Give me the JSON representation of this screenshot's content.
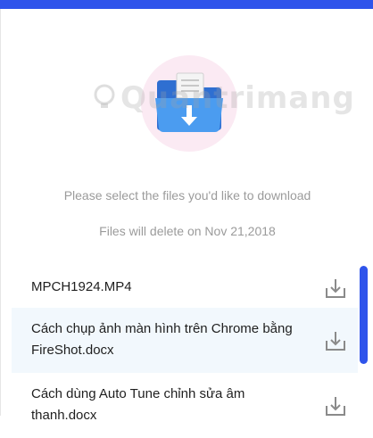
{
  "colors": {
    "accent": "#2f54eb",
    "folder": "#3b8de0",
    "hint_text": "#9b9b9b",
    "row_highlight": "#f2f8fd"
  },
  "watermark": {
    "text": "Quantrimang"
  },
  "hero": {
    "icon": "folder-download-icon"
  },
  "messages": {
    "select_prompt": "Please select the files you'd like to download",
    "delete_notice": "Files will delete on Nov 21,2018"
  },
  "files": [
    {
      "name": "MPCH1924.MP4",
      "icon": "download-icon"
    },
    {
      "name": "Cách chụp ảnh màn hình trên Chrome bằng FireShot.docx",
      "icon": "download-icon"
    },
    {
      "name": "Cách dùng Auto Tune chỉnh sửa âm thanh.docx",
      "icon": "download-icon"
    }
  ]
}
